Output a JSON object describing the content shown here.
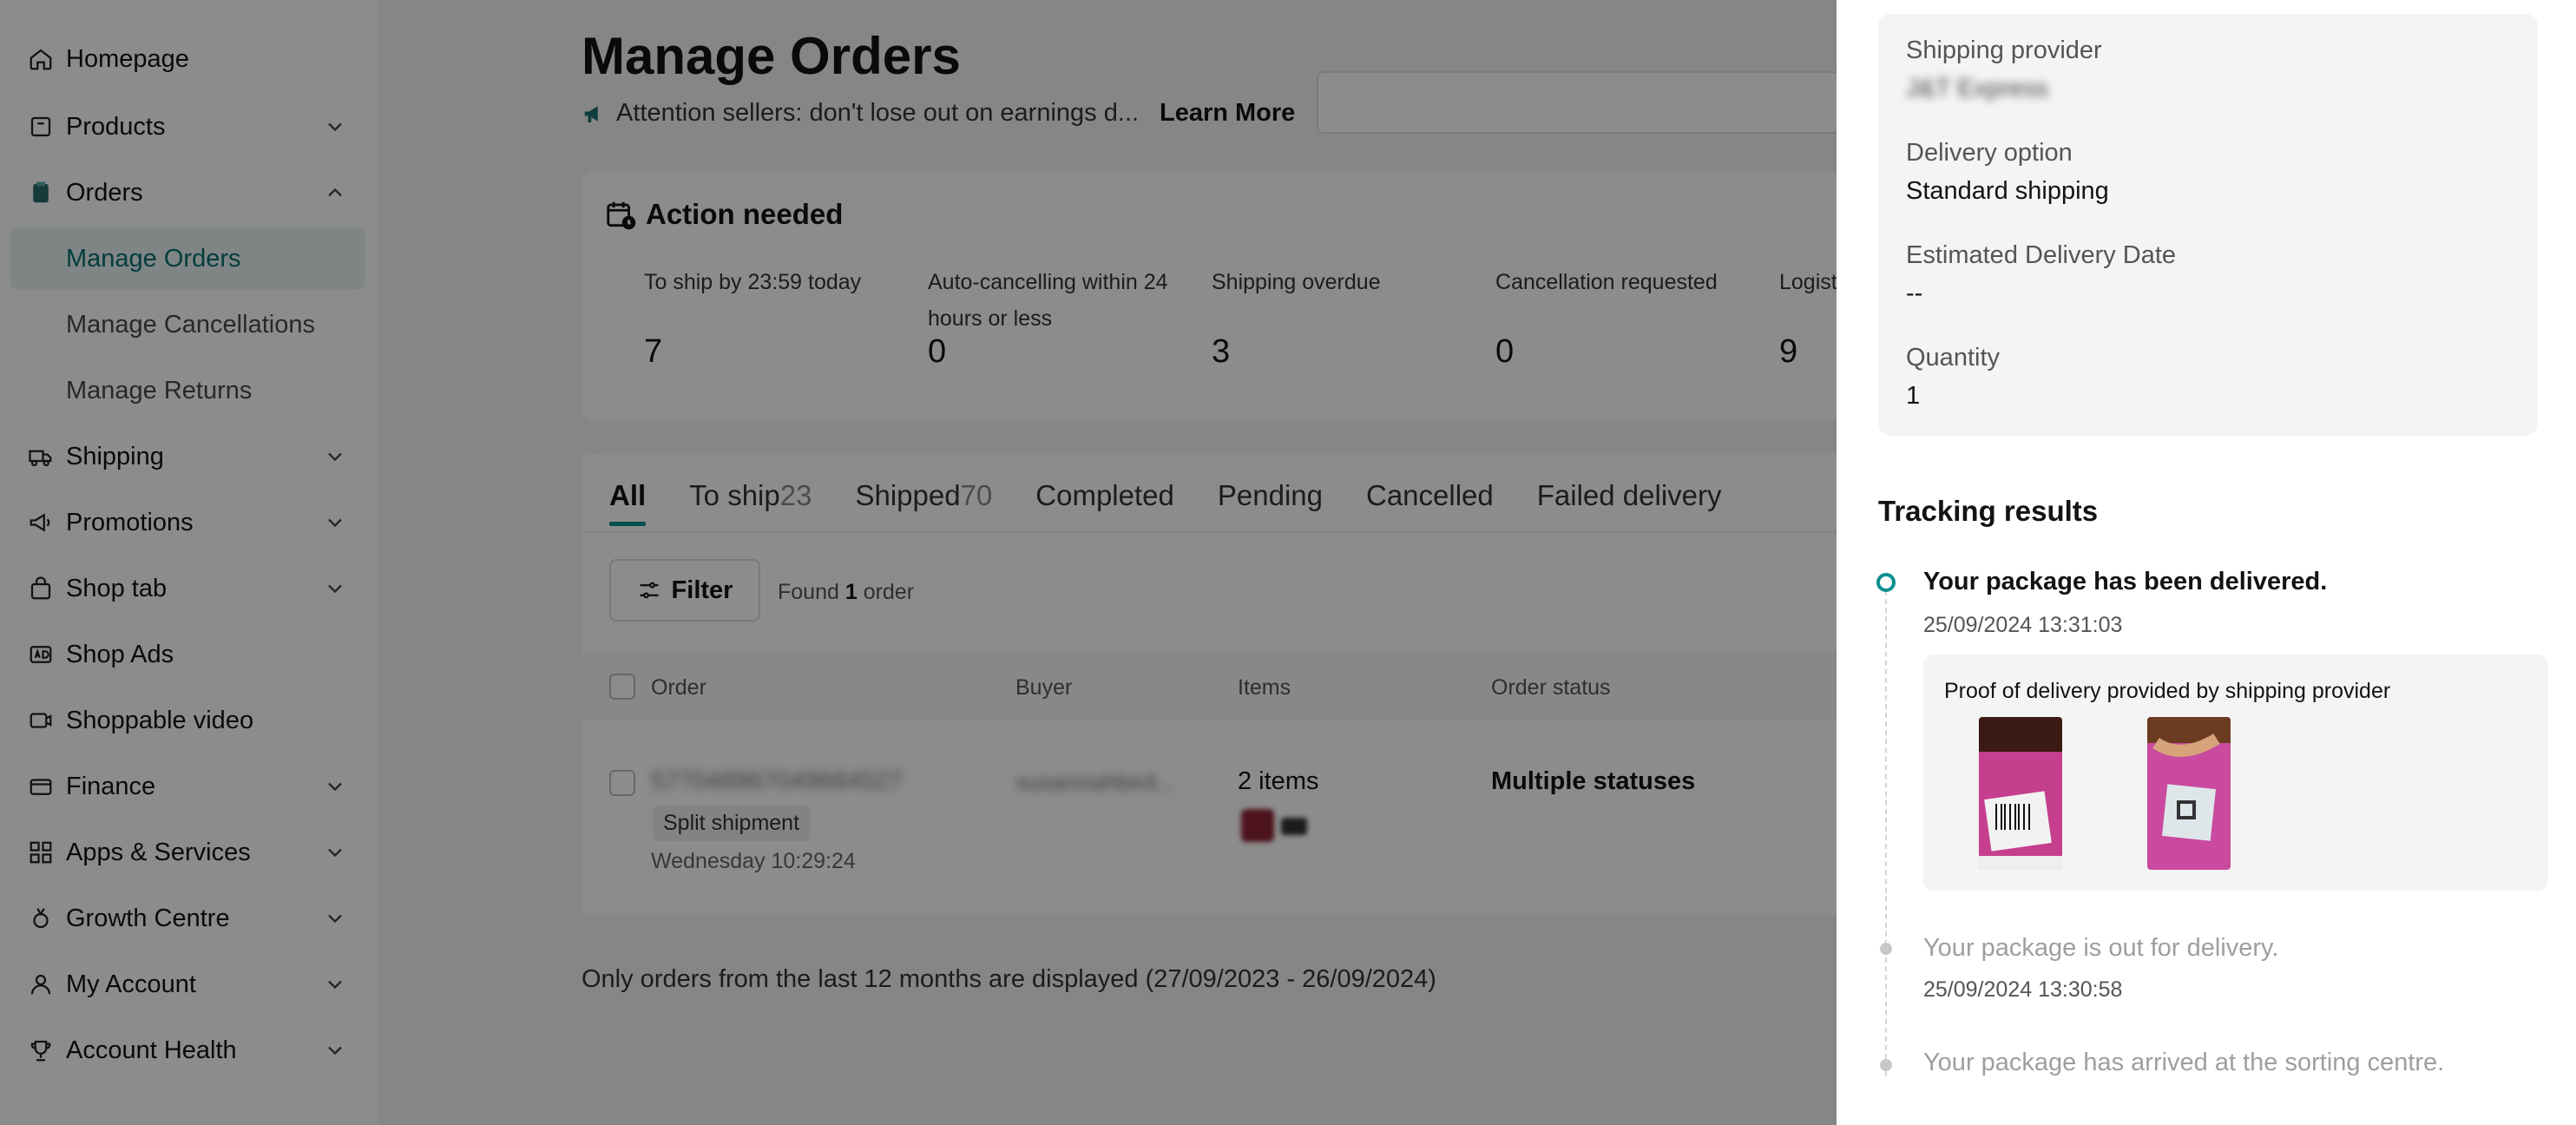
{
  "sidebar": {
    "items": [
      {
        "label": "Homepage",
        "icon": "home-icon",
        "has_chevron": false
      },
      {
        "label": "Products",
        "icon": "product-icon",
        "has_chevron": true
      },
      {
        "label": "Orders",
        "icon": "orders-icon",
        "has_chevron": true,
        "expanded": true
      },
      {
        "label": "Shipping",
        "icon": "truck-icon",
        "has_chevron": true
      },
      {
        "label": "Promotions",
        "icon": "megaphone-icon",
        "has_chevron": true
      },
      {
        "label": "Shop tab",
        "icon": "bag-icon",
        "has_chevron": true
      },
      {
        "label": "Shop Ads",
        "icon": "ad-icon",
        "has_chevron": false
      },
      {
        "label": "Shoppable video",
        "icon": "video-icon",
        "has_chevron": false
      },
      {
        "label": "Finance",
        "icon": "wallet-icon",
        "has_chevron": true
      },
      {
        "label": "Apps & Services",
        "icon": "apps-icon",
        "has_chevron": true
      },
      {
        "label": "Growth Centre",
        "icon": "growth-icon",
        "has_chevron": true
      },
      {
        "label": "My Account",
        "icon": "user-icon",
        "has_chevron": true
      },
      {
        "label": "Account Health",
        "icon": "trophy-icon",
        "has_chevron": true
      }
    ],
    "orders_sub": [
      "Manage Orders",
      "Manage Cancellations",
      "Manage Returns"
    ],
    "active_sub": "Manage Orders"
  },
  "main": {
    "title": "Manage Orders",
    "attention": "Attention sellers: don't lose out on earnings d...",
    "learn_more": "Learn More",
    "action_needed": {
      "title": "Action needed",
      "metrics": [
        {
          "label": "To ship by 23:59 today",
          "value": "7"
        },
        {
          "label": "Auto-cancelling within 24 hours or less",
          "value": "0"
        },
        {
          "label": "Shipping overdue",
          "value": "3"
        },
        {
          "label": "Cancellation requested",
          "value": "0"
        },
        {
          "label": "Logist",
          "value": "9"
        }
      ]
    },
    "tabs": [
      {
        "label": "All",
        "count": "",
        "active": true
      },
      {
        "label": "To ship",
        "count": "23",
        "active": false
      },
      {
        "label": "Shipped",
        "count": "70",
        "active": false
      },
      {
        "label": "Completed",
        "count": "",
        "active": false
      },
      {
        "label": "Pending",
        "count": "",
        "active": false
      },
      {
        "label": "Cancelled",
        "count": "",
        "active": false
      },
      {
        "label": "Failed delivery",
        "count": "",
        "active": false
      }
    ],
    "filter_label": "Filter",
    "found_prefix": "Found",
    "found_count": "1",
    "found_suffix": "order",
    "table": {
      "columns": [
        "Order",
        "Buyer",
        "Items",
        "Order status"
      ],
      "row": {
        "order_id": "577048967049684527",
        "badge": "Split shipment",
        "date": "Wednesday 10:29:24",
        "buyer": "susannahbird...",
        "items": "2 items",
        "status": "Multiple statuses"
      }
    },
    "footer_note": "Only orders from the last 12 months are displayed (27/09/2023 - 26/09/2024)"
  },
  "drawer": {
    "info": [
      {
        "label": "Shipping provider",
        "value": "J&T Express",
        "blurred": true
      },
      {
        "label": "Delivery option",
        "value": "Standard shipping",
        "blurred": false
      },
      {
        "label": "Estimated Delivery Date",
        "value": "--",
        "blurred": false
      },
      {
        "label": "Quantity",
        "value": "1",
        "blurred": false
      }
    ],
    "tracking_title": "Tracking results",
    "events": [
      {
        "title": "Your package has been delivered.",
        "date": "25/09/2024 13:31:03",
        "active": true
      },
      {
        "title": "Your package is out for delivery.",
        "date": "25/09/2024 13:30:58",
        "active": false
      },
      {
        "title": "Your package has arrived at the sorting centre.",
        "date": "",
        "active": false
      }
    ],
    "proof_label": "Proof of delivery provided by shipping provider"
  },
  "colors": {
    "accent": "#0a8f8f",
    "overlay": "rgba(0,0,0,0.45)"
  }
}
